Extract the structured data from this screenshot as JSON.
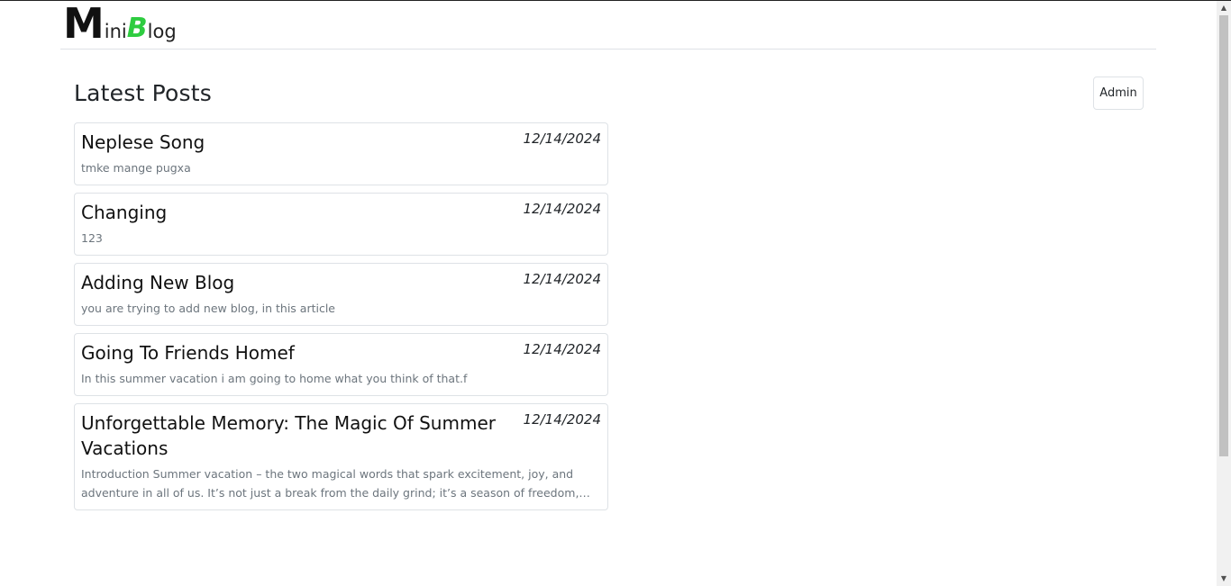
{
  "logo": {
    "m": "M",
    "ini": "ini",
    "b": "B",
    "log": "log"
  },
  "page_title": "Latest Posts",
  "admin_label": "Admin",
  "posts": [
    {
      "title": "Neplese Song",
      "date": "12/14/2024",
      "excerpt": "tmke mange pugxa"
    },
    {
      "title": "Changing",
      "date": "12/14/2024",
      "excerpt": "123"
    },
    {
      "title": "Adding New Blog",
      "date": "12/14/2024",
      "excerpt": "you are trying to add new blog, in this article"
    },
    {
      "title": "Going To Friends Homef",
      "date": "12/14/2024",
      "excerpt": "In this summer vacation i am going to home what you think of that.f"
    },
    {
      "title": "Unforgettable Memory: The Magic Of Summer Vacations",
      "date": "12/14/2024",
      "excerpt": "Introduction Summer vacation – the two magical words that spark excitement, joy, and adventure in all of us. It’s not just a break from the daily grind; it’s a season of freedom,…"
    }
  ],
  "colors": {
    "brand_green": "#2ecc40",
    "muted_text": "#6c757d",
    "border": "#dee2e6"
  }
}
